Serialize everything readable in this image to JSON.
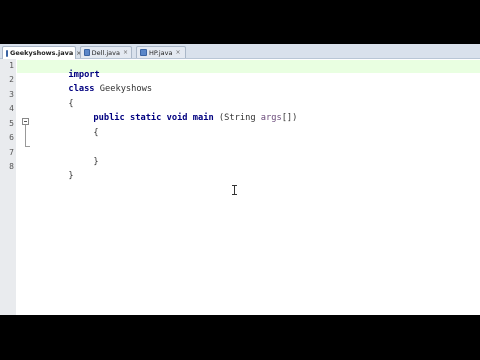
{
  "tabs": [
    {
      "label": "Geekyshows.java",
      "active": true
    },
    {
      "label": "Dell.java",
      "active": false
    },
    {
      "label": "HP.java",
      "active": false
    }
  ],
  "gutter": {
    "line_numbers": [
      "1",
      "2",
      "3",
      "4",
      "5",
      "6",
      "7",
      "8"
    ]
  },
  "code": {
    "line1": {
      "kw": "import"
    },
    "line2": {
      "kw": "class",
      "name": " Geekyshows"
    },
    "line3": {
      "text": "{"
    },
    "line4": {
      "kw": "public static void main",
      "rest": " (String ",
      "param": "args",
      "end": "[])"
    },
    "line5": {
      "text": "{"
    },
    "line6": {
      "text": ""
    },
    "line7": {
      "text": "}"
    },
    "line8": {
      "text": "}"
    }
  },
  "colors": {
    "keyword": "#00007f",
    "current_line": "#e9ffe1",
    "tabbar": "#d9e1ec"
  }
}
